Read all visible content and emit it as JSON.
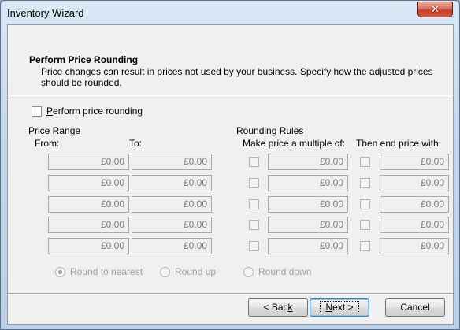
{
  "window": {
    "title": "Inventory Wizard",
    "close_glyph": "✕"
  },
  "header": {
    "title": "Perform Price Rounding",
    "description": "Price changes can result in prices not used by your business.  Specify how the adjusted prices should be rounded."
  },
  "rounding_toggle": {
    "label_accel": "P",
    "label_rest": "erform price rounding",
    "checked": false
  },
  "price_range": {
    "label": "Price Range",
    "from_label": "From:",
    "to_label": "To:"
  },
  "rounding_rules": {
    "label": "Rounding Rules",
    "multiple_label": "Make price a multiple of:",
    "end_label": "Then end price with:"
  },
  "rows": [
    {
      "from": "£0.00",
      "to": "£0.00",
      "multiple": "£0.00",
      "end": "£0.00"
    },
    {
      "from": "£0.00",
      "to": "£0.00",
      "multiple": "£0.00",
      "end": "£0.00"
    },
    {
      "from": "£0.00",
      "to": "£0.00",
      "multiple": "£0.00",
      "end": "£0.00"
    },
    {
      "from": "£0.00",
      "to": "£0.00",
      "multiple": "£0.00",
      "end": "£0.00"
    },
    {
      "from": "£0.00",
      "to": "£0.00",
      "multiple": "£0.00",
      "end": "£0.00"
    }
  ],
  "round_mode": {
    "options": [
      "Round to nearest",
      "Round up",
      "Round down"
    ],
    "selected": "Round to nearest"
  },
  "buttons": {
    "back_pre": "< Bac",
    "back_accel": "k",
    "next_accel": "N",
    "next_rest": "ext >",
    "cancel": "Cancel"
  }
}
